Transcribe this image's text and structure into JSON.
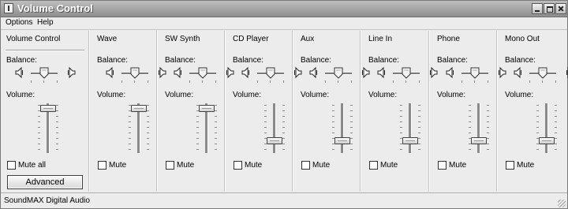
{
  "window": {
    "title": "Volume Control",
    "icon": "speaker-app-icon"
  },
  "title_buttons": [
    "minimize-icon",
    "maximize-icon",
    "close-icon"
  ],
  "menu": {
    "options": "Options",
    "help": "Help"
  },
  "labels": {
    "balance": "Balance:",
    "volume": "Volume:"
  },
  "channels": [
    {
      "key": "main",
      "name": "Volume Control",
      "mute_label": "Mute all",
      "muted": false,
      "balance": 0.5,
      "volume": 0.95
    },
    {
      "key": "wave",
      "name": "Wave",
      "mute_label": "Mute",
      "muted": false,
      "balance": 0.5,
      "volume": 0.95
    },
    {
      "key": "sw-synth",
      "name": "SW Synth",
      "mute_label": "Mute",
      "muted": false,
      "balance": 0.5,
      "volume": 0.95
    },
    {
      "key": "cd-player",
      "name": "CD Player",
      "mute_label": "Mute",
      "muted": false,
      "balance": 0.5,
      "volume": 0.25
    },
    {
      "key": "aux",
      "name": "Aux",
      "mute_label": "Mute",
      "muted": false,
      "balance": 0.5,
      "volume": 0.25
    },
    {
      "key": "line-in",
      "name": "Line In",
      "mute_label": "Mute",
      "muted": false,
      "balance": 0.5,
      "volume": 0.25
    },
    {
      "key": "phone",
      "name": "Phone",
      "mute_label": "Mute",
      "muted": false,
      "balance": 0.5,
      "volume": 0.25
    },
    {
      "key": "mono-out",
      "name": "Mono Out",
      "mute_label": "Mute",
      "muted": false,
      "balance": 0.5,
      "volume": 0.25
    }
  ],
  "advanced_button": "Advanced",
  "status": "SoundMAX Digital Audio"
}
